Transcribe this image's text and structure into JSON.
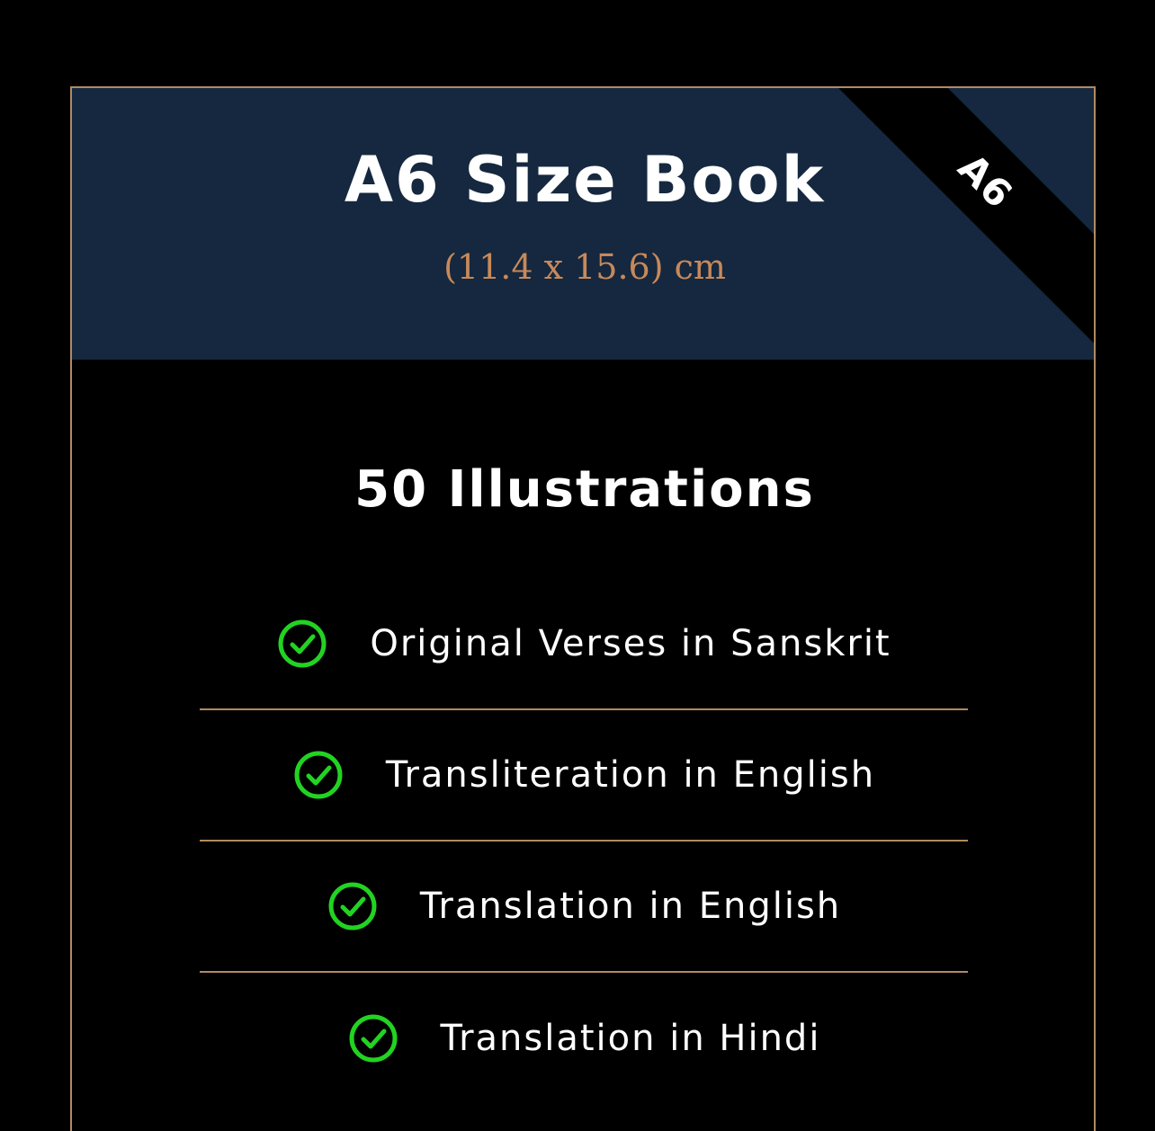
{
  "card": {
    "title": "A6 Size Book",
    "subtitle": "(11.4 x 15.6) cm",
    "ribbon_label": "A6",
    "section_heading": "50 Illustrations",
    "features": [
      {
        "label": "Original Verses in Sanskrit",
        "icon": "check-circle-icon"
      },
      {
        "label": "Transliteration in English",
        "icon": "check-circle-icon"
      },
      {
        "label": "Translation in English",
        "icon": "check-circle-icon"
      },
      {
        "label": "Translation in Hindi",
        "icon": "check-circle-icon"
      }
    ]
  },
  "colors": {
    "background": "#000000",
    "header_bg": "#15283f",
    "accent": "#c8895a",
    "border": "#b08a62",
    "check": "#22d322",
    "text": "#ffffff"
  }
}
